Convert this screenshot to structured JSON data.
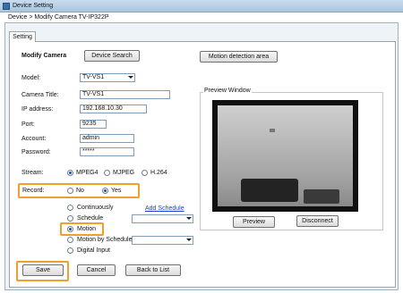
{
  "window": {
    "title": "Device Setting"
  },
  "breadcrumb": "Device > Modify Camera TV-IP322P",
  "tabs": [
    {
      "label": "Setting"
    }
  ],
  "form": {
    "heading": "Modify Camera",
    "device_search_label": "Device Search",
    "motion_area_label": "Motion detection area",
    "model_label": "Model:",
    "model_value": "TV-VS1",
    "camera_title_label": "Camera Title:",
    "camera_title_value": "TV-VS1",
    "ip_label": "IP address:",
    "ip_value": "192.168.10.30",
    "port_label": "Port:",
    "port_value": "9235",
    "account_label": "Account:",
    "account_value": "admin",
    "password_label": "Password:",
    "password_value": "*****",
    "stream_label": "Stream:",
    "stream_options": [
      "MPEG4",
      "MJPEG",
      "H.264"
    ],
    "stream_selected": "MPEG4",
    "record_label": "Record:",
    "record_options": [
      "No",
      "Yes"
    ],
    "record_selected": "Yes",
    "record_modes": [
      "Continuously",
      "Schedule",
      "Motion",
      "Motion by Schedule",
      "Digital Input"
    ],
    "record_mode_selected": "Motion",
    "add_schedule_label": "Add Schedule"
  },
  "preview": {
    "group_label": "Preview Window",
    "preview_button": "Preview",
    "disconnect_button": "Disconnect"
  },
  "footer": {
    "save_label": "Save",
    "cancel_label": "Cancel",
    "back_label": "Back to List"
  },
  "colors": {
    "highlight": "#f0a02a",
    "link": "#1a3fd6"
  }
}
